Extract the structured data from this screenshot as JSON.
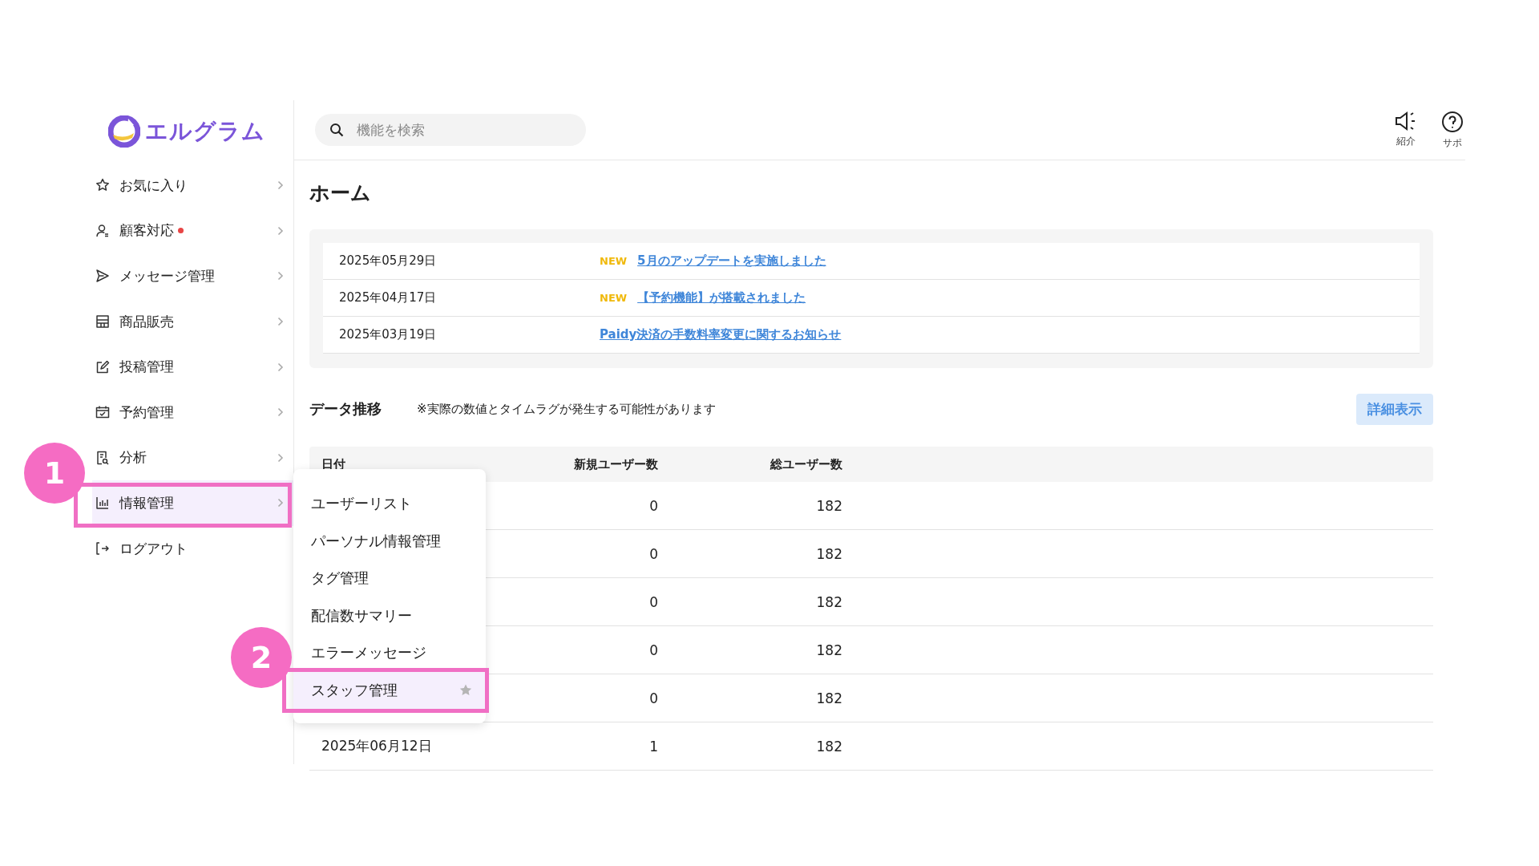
{
  "logo": {
    "text": "エルグラム"
  },
  "search": {
    "placeholder": "機能を検索"
  },
  "header_actions": [
    {
      "label": "紹介"
    },
    {
      "label": "サポ"
    }
  ],
  "sidebar": {
    "items": [
      {
        "label": "お気に入り",
        "notification": false,
        "selected": false
      },
      {
        "label": "顧客対応",
        "notification": true,
        "selected": false
      },
      {
        "label": "メッセージ管理",
        "notification": false,
        "selected": false
      },
      {
        "label": "商品販売",
        "notification": false,
        "selected": false
      },
      {
        "label": "投稿管理",
        "notification": false,
        "selected": false
      },
      {
        "label": "予約管理",
        "notification": false,
        "selected": false
      },
      {
        "label": "分析",
        "notification": false,
        "selected": false
      },
      {
        "label": "情報管理",
        "notification": false,
        "selected": true
      },
      {
        "label": "ログアウト",
        "notification": false,
        "selected": false
      }
    ]
  },
  "page_title": "ホーム",
  "news": [
    {
      "date": "2025年05月29日",
      "new": true,
      "badge": "NEW",
      "title": "5月のアップデートを実施しました"
    },
    {
      "date": "2025年04月17日",
      "new": true,
      "badge": "NEW",
      "title": "【予約機能】が搭載されました"
    },
    {
      "date": "2025年03月19日",
      "new": false,
      "title": "Paidy決済の手数料率変更に関するお知らせ"
    }
  ],
  "data_section": {
    "title": "データ推移",
    "note": "※実際の数値とタイムラグが発生する可能性があります",
    "button": "詳細表示"
  },
  "table": {
    "columns": [
      "日付",
      "新規ユーザー数",
      "総ユーザー数"
    ],
    "rows": [
      {
        "new_users": "0",
        "total_users": "182"
      },
      {
        "new_users": "0",
        "total_users": "182"
      },
      {
        "new_users": "0",
        "total_users": "182"
      },
      {
        "new_users": "0",
        "total_users": "182"
      },
      {
        "new_users": "0",
        "total_users": "182"
      },
      {
        "date": "2025年06月12日",
        "new_users": "1",
        "total_users": "182"
      }
    ]
  },
  "submenu": {
    "items": [
      {
        "label": "ユーザーリスト",
        "selected": false
      },
      {
        "label": "パーソナル情報管理",
        "selected": false
      },
      {
        "label": "タグ管理",
        "selected": false
      },
      {
        "label": "配信数サマリー",
        "selected": false
      },
      {
        "label": "エラーメッセージ",
        "selected": false
      },
      {
        "label": "スタッフ管理",
        "selected": true
      }
    ]
  },
  "annotations": [
    {
      "label": "1"
    },
    {
      "label": "2"
    }
  ]
}
